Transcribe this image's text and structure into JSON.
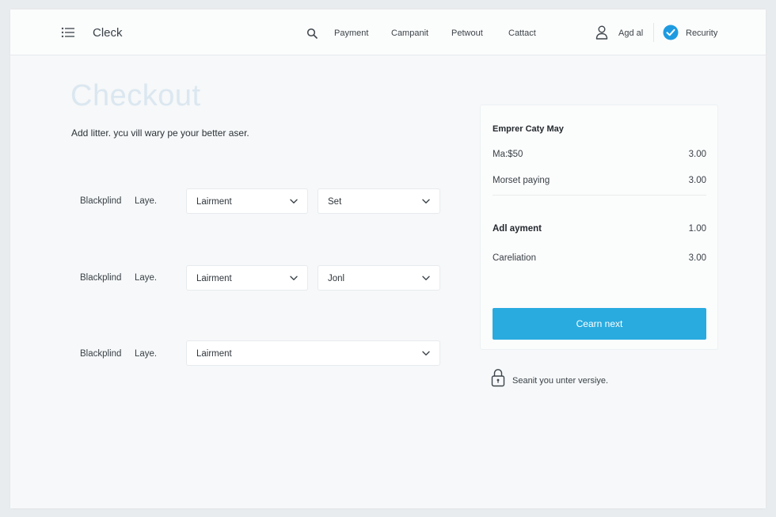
{
  "header": {
    "brand": "Cleck",
    "nav": [
      "Payment",
      "Campanit",
      "Petwout",
      "Cattact"
    ],
    "user_label": "Agd al",
    "security_label": "Recurity"
  },
  "main": {
    "title": "Checkout",
    "subtitle": "Add litter. ycu vill wary pe your better aser.",
    "rows": [
      {
        "label": "Blackplind",
        "sublabel": "Laye.",
        "select1": "Lairment",
        "select2": "Set"
      },
      {
        "label": "Blackplind",
        "sublabel": "Laye.",
        "select1": "Lairment",
        "select2": "Jonl"
      },
      {
        "label": "Blackplind",
        "sublabel": "Laye.",
        "select1": "Lairment"
      }
    ]
  },
  "summary": {
    "title": "Emprer Caty May",
    "lines": [
      {
        "label": "Ma:$50",
        "amount": "3.00"
      },
      {
        "label": "Morset paying",
        "amount": "3.00"
      },
      {
        "label": "Adl ayment",
        "amount": "1.00"
      },
      {
        "label": "Careliation",
        "amount": "3.00"
      }
    ],
    "cta": "Cearn next"
  },
  "secure_note": "Seanit you unter versiye.",
  "colors": {
    "accent": "#29abe0",
    "title": "#dbe7f0",
    "background": "#f6f8f9"
  },
  "icons": [
    "menu-icon",
    "search-icon",
    "user-icon",
    "check-badge-icon",
    "chevron-down-icon",
    "lock-icon"
  ]
}
